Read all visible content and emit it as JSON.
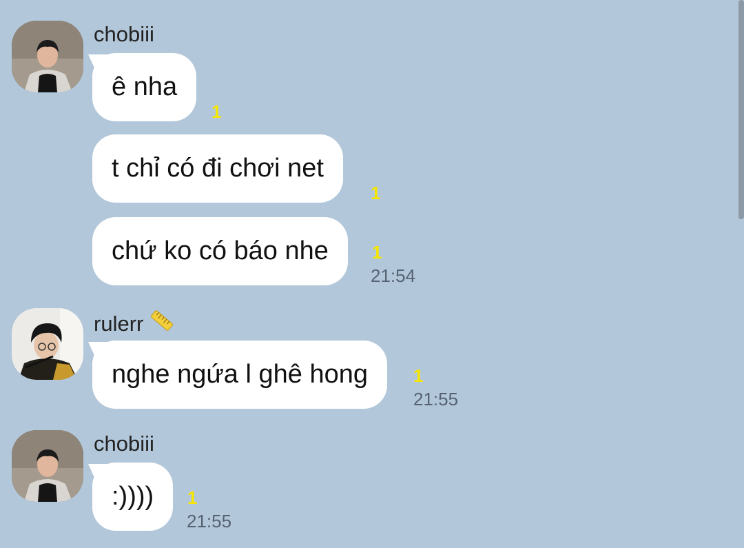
{
  "groups": [
    {
      "sender": "chobiii",
      "avatar": "avatar-chobiii",
      "messages": [
        {
          "text": "ê nha",
          "unread": "1",
          "time": ""
        },
        {
          "text": "t chỉ có đi chơi net",
          "unread": "1",
          "time": ""
        },
        {
          "text": "chứ ko có báo nhe",
          "unread": "1",
          "time": "21:54"
        }
      ]
    },
    {
      "sender": "rulerr",
      "sender_emoji": "ruler-icon",
      "avatar": "avatar-rulerr",
      "messages": [
        {
          "text": "nghe ngứa l ghê hong",
          "unread": "1",
          "time": "21:55"
        }
      ]
    },
    {
      "sender": "chobiii",
      "avatar": "avatar-chobiii",
      "messages": [
        {
          "text": ":))))",
          "unread": "1",
          "time": "21:55"
        }
      ]
    }
  ],
  "colors": {
    "background": "#b2c7d9",
    "bubble": "#ffffff",
    "unread": "#f5e500",
    "time": "#566272"
  }
}
